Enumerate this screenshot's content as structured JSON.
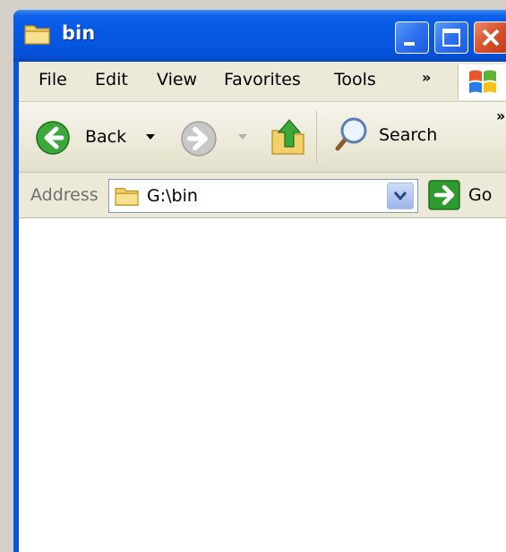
{
  "window": {
    "title": "bin"
  },
  "menu": {
    "items": [
      "File",
      "Edit",
      "View",
      "Favorites",
      "Tools"
    ],
    "overflow": "»"
  },
  "toolbar": {
    "back_label": "Back",
    "search_label": "Search",
    "overflow": "»"
  },
  "address": {
    "label": "Address",
    "value": "G:\\bin",
    "go_label": "Go"
  },
  "colors": {
    "titlebar_blue": "#0758e2",
    "window_face": "#ece9d8",
    "go_green": "#2f9b2f",
    "back_green": "#3aa83a"
  },
  "icons": [
    "folder-icon",
    "minimize-icon",
    "maximize-icon",
    "close-icon",
    "windows-logo-icon",
    "back-arrow-icon",
    "forward-arrow-icon",
    "folder-up-icon",
    "search-icon",
    "dropdown-arrow-icon",
    "go-arrow-icon"
  ]
}
